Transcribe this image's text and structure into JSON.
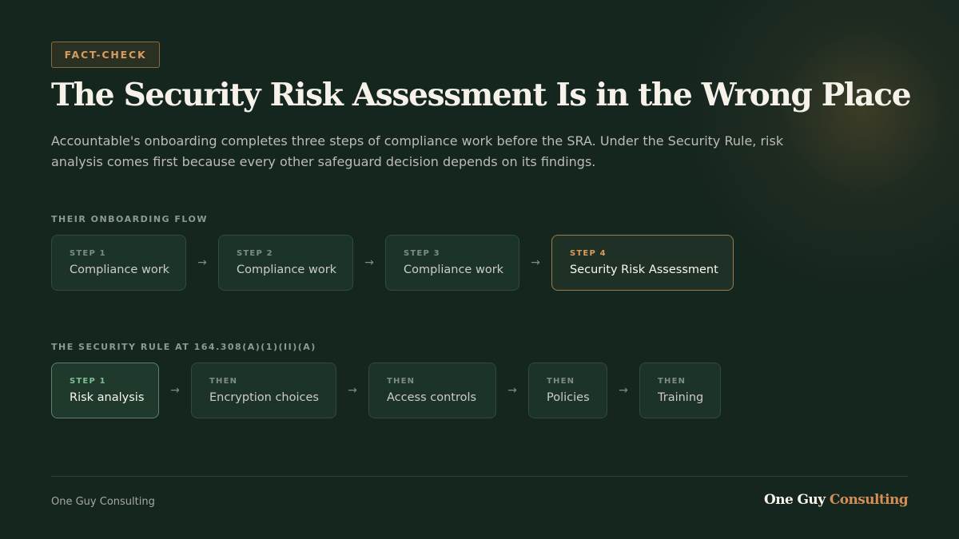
{
  "badge": "FACT-CHECK",
  "title": "The Security Risk Assessment Is in the Wrong Place",
  "subtitle": "Accountable's onboarding completes three steps of compliance work before the SRA. Under the Security Rule, risk analysis comes first because every other safeguard decision depends on its findings.",
  "flow1": {
    "label": "THEIR ONBOARDING FLOW",
    "steps": [
      {
        "k": "STEP 1",
        "v": "Compliance work"
      },
      {
        "k": "STEP 2",
        "v": "Compliance work"
      },
      {
        "k": "STEP 3",
        "v": "Compliance work"
      },
      {
        "k": "STEP 4",
        "v": "Security Risk Assessment"
      }
    ]
  },
  "flow2": {
    "label": "THE SECURITY RULE AT 164.308(A)(1)(II)(A)",
    "steps": [
      {
        "k": "STEP 1",
        "v": "Risk analysis"
      },
      {
        "k": "THEN",
        "v": "Encryption choices"
      },
      {
        "k": "THEN",
        "v": "Access controls"
      },
      {
        "k": "THEN",
        "v": "Policies"
      },
      {
        "k": "THEN",
        "v": "Training"
      }
    ]
  },
  "arrow_glyph": "→",
  "footer": {
    "left": "One Guy Consulting",
    "brand_a": "One Guy",
    "brand_b": "Consulting"
  },
  "colors": {
    "background": "#15261f",
    "accent_gold": "#d99d60",
    "accent_green": "#7fbf92"
  }
}
